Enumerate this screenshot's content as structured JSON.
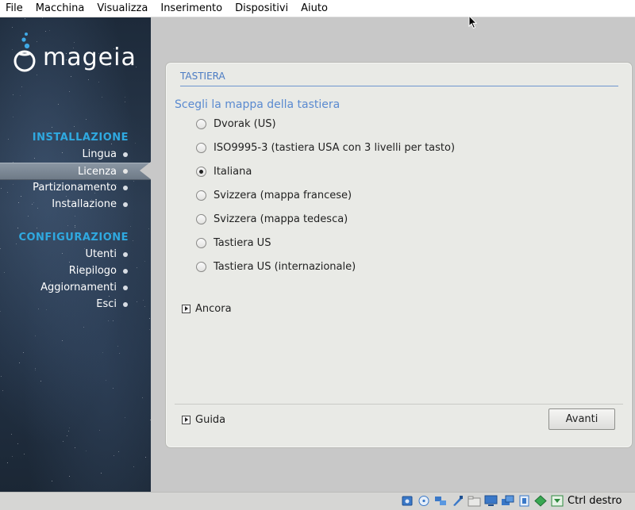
{
  "menubar": [
    "File",
    "Macchina",
    "Visualizza",
    "Inserimento",
    "Dispositivi",
    "Aiuto"
  ],
  "sidebar": {
    "logo_text": "mageia",
    "sections": [
      {
        "heading": "INSTALLAZIONE",
        "items": [
          "Lingua",
          "Licenza",
          "Partizionamento",
          "Installazione"
        ]
      },
      {
        "heading": "CONFIGURAZIONE",
        "items": [
          "Utenti",
          "Riepilogo",
          "Aggiornamenti",
          "Esci"
        ]
      }
    ],
    "active_item": "Licenza"
  },
  "panel": {
    "title": "TASTIERA",
    "subtitle": "Scegli la mappa della tastiera",
    "options": [
      "Dvorak (US)",
      "ISO9995-3 (tastiera USA con 3 livelli per tasto)",
      "Italiana",
      "Svizzera (mappa francese)",
      "Svizzera (mappa tedesca)",
      "Tastiera US",
      "Tastiera US (internazionale)"
    ],
    "selected_option": "Italiana",
    "more_label": "Ancora",
    "help_label": "Guida",
    "next_button": "Avanti"
  },
  "statusbar": {
    "icons": [
      "hdd-icon",
      "cd-icon",
      "network-icon",
      "usb-icon",
      "shared-folder-icon",
      "display-icon",
      "screen-capture-icon",
      "cpu-icon",
      "video-capture-icon",
      "arrow-down-icon"
    ],
    "host_key": "Ctrl destro"
  },
  "colors": {
    "accent": "#2fa9e0",
    "title": "#4a7bc3",
    "panel_bg": "#e9eae6",
    "desktop_bg": "#c8c8c8"
  }
}
